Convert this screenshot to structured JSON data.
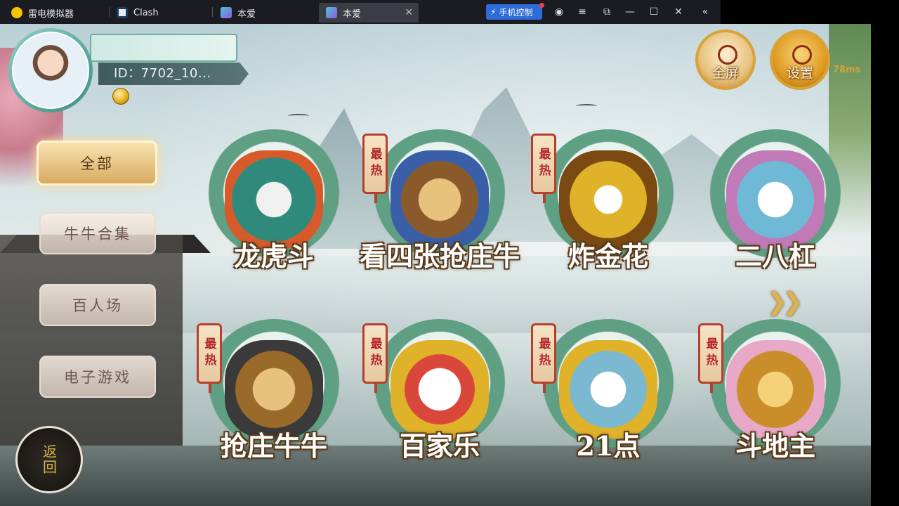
{
  "window": {
    "tabs": [
      {
        "label": "雷电模拟器",
        "icon": "emulator-logo-icon",
        "color": "#f5c400"
      },
      {
        "label": "Clash",
        "icon": "clash-app-icon",
        "color": "#e7ecf2"
      },
      {
        "label": "本爱",
        "icon": "game-app-icon",
        "color": "#8d5ad8"
      },
      {
        "label": "本爱",
        "icon": "game-app-icon",
        "color": "#8d5ad8",
        "active": true
      }
    ],
    "phone_control_label": "手机控制"
  },
  "player": {
    "id_text": "ID：7702_10...",
    "coins": "179.01"
  },
  "top_buttons": {
    "fullscreen_label": "全屏",
    "settings_label": "设置",
    "ping": "78ms"
  },
  "menu": {
    "items": [
      {
        "label": "全部",
        "selected": true
      },
      {
        "label": "牛牛合集",
        "selected": false
      },
      {
        "label": "百人场",
        "selected": false
      },
      {
        "label": "电子游戏",
        "selected": false
      }
    ]
  },
  "back_button_label": "返回",
  "hot_badge_label": "最热",
  "games": [
    {
      "name": "龙虎斗",
      "hot": false,
      "art_color": "#2f8a7c"
    },
    {
      "name": "看四张抢庄牛",
      "hot": true,
      "art_color": "#c79b3e"
    },
    {
      "name": "炸金花",
      "hot": true,
      "art_color": "#d4a52c"
    },
    {
      "name": "二八杠",
      "hot": false,
      "art_color": "#6fb9d6"
    },
    {
      "name": "抢庄牛牛",
      "hot": true,
      "art_color": "#9a6a2a"
    },
    {
      "name": "百家乐",
      "hot": true,
      "art_color": "#d9473a"
    },
    {
      "name": "21点",
      "hot": true,
      "art_color": "#7ab9cf"
    },
    {
      "name": "斗地主",
      "hot": true,
      "art_color": "#c98d2a"
    }
  ]
}
